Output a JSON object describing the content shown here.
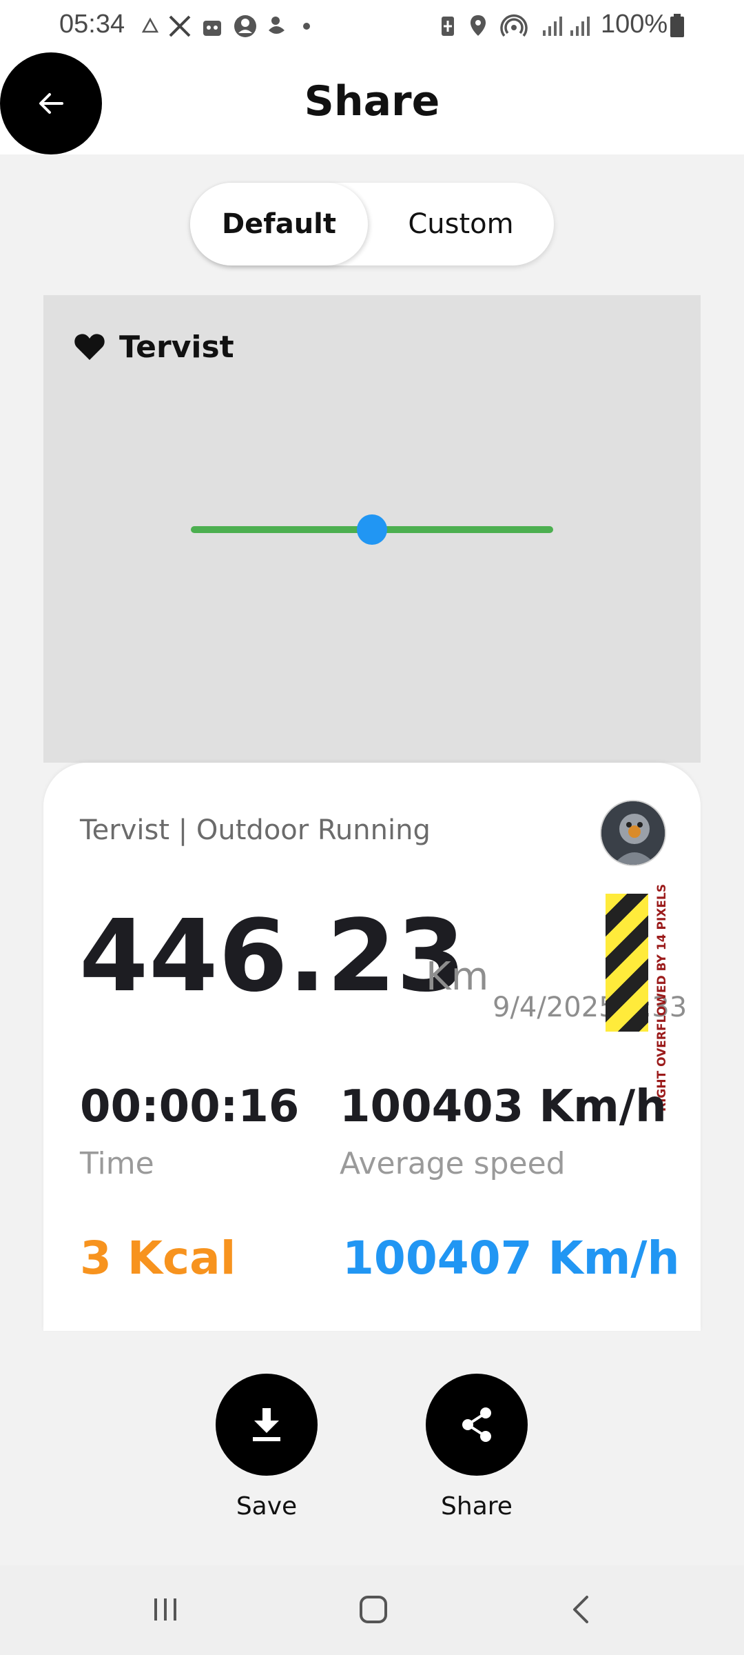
{
  "status_bar": {
    "time": "05:34",
    "battery_text": "100%",
    "left_icons": [
      "warning-icon",
      "x-icon",
      "bag-icon",
      "account-icon",
      "duck-icon",
      "dot-icon"
    ],
    "right_icons": [
      "battery-saver-icon",
      "location-icon",
      "hotspot-icon",
      "signal-icon",
      "signal-icon",
      "battery-icon"
    ]
  },
  "header": {
    "title": "Share",
    "back_icon": "arrow-left-icon"
  },
  "tabs": [
    {
      "label": "Default",
      "selected": true
    },
    {
      "label": "Custom",
      "selected": false
    }
  ],
  "map": {
    "brand": "Tervist",
    "brand_icon": "heart-icon",
    "route_color": "#4caf50",
    "marker_color": "#2196f3"
  },
  "card": {
    "activity": "Tervist | Outdoor Running",
    "distance": "446.23",
    "distance_unit": "Km",
    "date": "9/4/2025 3:33",
    "overflow_warning": "RIGHT OVERFLOWED BY 14 PIXELS",
    "time_value": "00:00:16",
    "time_label": "Time",
    "speed_value": "100403 Km/h",
    "speed_label": "Average speed",
    "kcal_value": "3 Kcal",
    "speed2_value": "100407 Km/h",
    "kcal_color": "#f7931e",
    "speed2_color": "#2196f3"
  },
  "actions": {
    "save_label": "Save",
    "save_icon": "download-icon",
    "share_label": "Share",
    "share_icon": "share-icon"
  },
  "nav": {
    "icons": [
      "recents-icon",
      "home-icon",
      "back-icon"
    ]
  }
}
